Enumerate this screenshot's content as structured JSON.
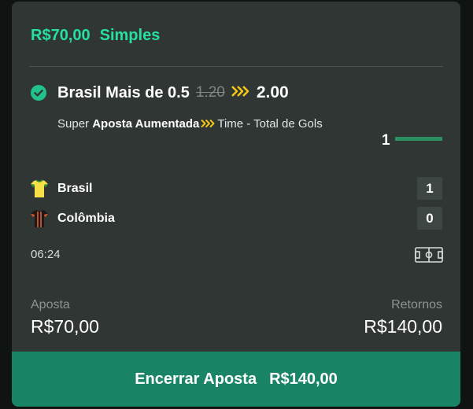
{
  "bet": {
    "stake_display": "R$70,00",
    "bet_type": "Simples"
  },
  "selection": {
    "name": "Brasil Mais de 0.5",
    "old_odds": "1.20",
    "new_odds": "2.00",
    "market_prefix": "Super",
    "market_boost": "Aposta Aumentada",
    "market_name": "Time - Total de Gols",
    "progress_value": "1",
    "status_icon": "check-circle-icon"
  },
  "match": {
    "teams": [
      {
        "name": "Brasil",
        "score": "1",
        "shirt_color": "#f5e046"
      },
      {
        "name": "Colômbia",
        "score": "0",
        "shirt_color": "#1a1a1a"
      }
    ],
    "clock": "06:24"
  },
  "footer": {
    "stake_label": "Aposta",
    "stake_value": "R$70,00",
    "returns_label": "Retornos",
    "returns_value": "R$140,00"
  },
  "cashout": {
    "label": "Encerrar Aposta",
    "amount": "R$140,00"
  },
  "colors": {
    "accent": "#27e0a0",
    "boost": "#f5c518",
    "cashout_bg": "#1a8566",
    "card_bg": "#2f3634"
  }
}
